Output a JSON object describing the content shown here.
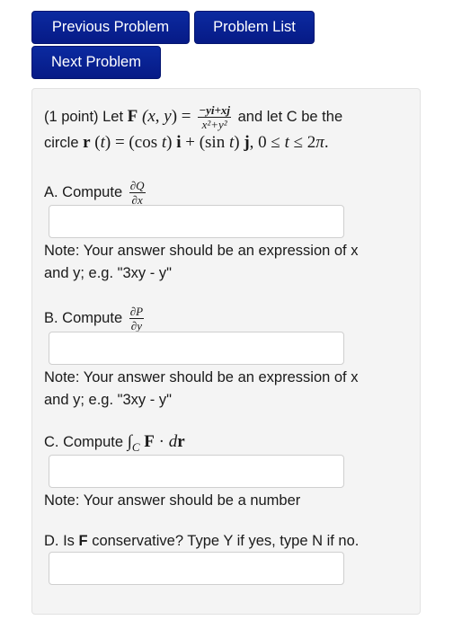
{
  "nav": {
    "previous_label": "Previous Problem",
    "list_label": "Problem List",
    "next_label": "Next Problem"
  },
  "colors": {
    "button_bg": "#061a86",
    "button_text": "#ffffff",
    "panel_bg": "#f4f4f4"
  },
  "problem": {
    "points_prefix": "(1 point) Let ",
    "field_name": "F",
    "field_args": "(x, y) = ",
    "field_numerator": "−yi+xj",
    "field_denominator": "x²+y²",
    "intro_suffix": " and let C be the",
    "curve_prefix": "circle ",
    "curve_expr": "r (t) = (cos t) i + (sin t) j, 0 ≤ t ≤ 2π.",
    "parts": [
      {
        "label": "A. Compute ",
        "math_num": "∂Q",
        "math_den": "∂x",
        "answer_value": "",
        "note_line1": "Note: Your answer should be an expression of x",
        "note_line2": "and y; e.g. \"3xy - y\""
      },
      {
        "label": "B. Compute ",
        "math_num": "∂P",
        "math_den": "∂y",
        "answer_value": "",
        "note_line1": "Note: Your answer should be an expression of x",
        "note_line2": "and y; e.g. \"3xy - y\""
      },
      {
        "label": "C. Compute ",
        "math_expr": "∫",
        "math_sub": "C",
        "math_rest_F": "F",
        "math_rest_dot": " · ",
        "math_rest_d": "d",
        "math_rest_r": "r",
        "answer_value": "",
        "note_line1": "Note: Your answer should be a number"
      },
      {
        "label_prefix": "D. Is ",
        "label_bold": "F",
        "label_suffix": " conservative? Type Y if yes, type N if no.",
        "answer_value": ""
      }
    ]
  }
}
